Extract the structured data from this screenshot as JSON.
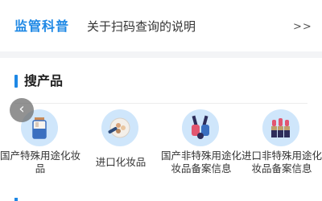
{
  "notice": {
    "brand": "监管科普",
    "text": "关于扫码查询的说明",
    "more": ">>"
  },
  "section": {
    "title": "搜产品",
    "prev_arrow": "‹"
  },
  "items": [
    {
      "label": "国产特殊用途化妆品",
      "icon": "foundation-bottle-icon"
    },
    {
      "label": "进口化妆品",
      "icon": "makeup-palette-icon"
    },
    {
      "label": "国产非特殊用途化妆品备案信息",
      "icon": "nail-polish-icon"
    },
    {
      "label": "进口非特殊用途化妆品备案信息",
      "icon": "lipstick-icon"
    }
  ],
  "colors": {
    "accent": "#1e88e5",
    "icon_bg": "#cfe6fb"
  }
}
